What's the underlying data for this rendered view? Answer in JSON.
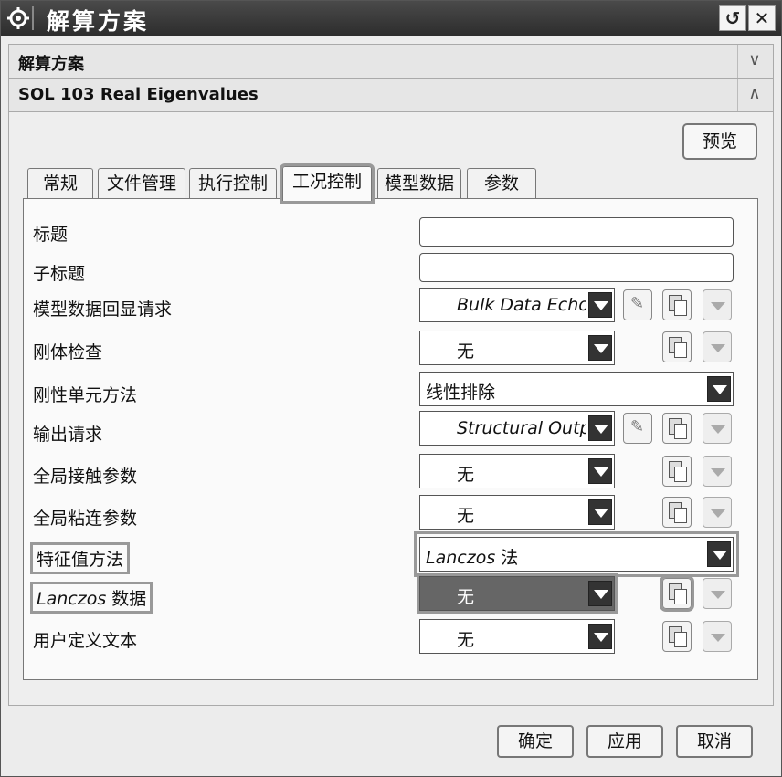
{
  "window": {
    "title": "解算方案",
    "icon": "gear-icon",
    "reset_icon": "↺",
    "close_icon": "✕"
  },
  "groups": {
    "solution": {
      "label": "解算方案",
      "chevron": "∨"
    },
    "sol103": {
      "label": "SOL 103 Real Eigenvalues",
      "chevron": "∧"
    }
  },
  "preview_button": "预览",
  "tabs": [
    {
      "label": "常规"
    },
    {
      "label": "文件管理"
    },
    {
      "label": "执行控制"
    },
    {
      "label": "工况控制"
    },
    {
      "label": "模型数据"
    },
    {
      "label": "参数"
    }
  ],
  "active_tab": "工况控制",
  "rows": {
    "title": {
      "label": "标题",
      "value": ""
    },
    "subtitle": {
      "label": "子标题",
      "value": ""
    },
    "model_echo": {
      "label": "模型数据回显请求",
      "value": "Bulk Data Echo"
    },
    "rigid_check": {
      "label": "刚体检查",
      "value": "无"
    },
    "rigid_method": {
      "label": "刚性单元方法",
      "value": "线性排除"
    },
    "output": {
      "label": "输出请求",
      "value": "Structural Outp"
    },
    "contact": {
      "label": "全局接触参数",
      "value": "无"
    },
    "glue": {
      "label": "全局粘连参数",
      "value": "无"
    },
    "eigen_method": {
      "label": "特征值方法",
      "value_italic": "Lanczos",
      "value_suffix": " 法"
    },
    "lanczos_data": {
      "label_italic": "Lanczos",
      "label_suffix": " 数据",
      "value": "无"
    },
    "user_text": {
      "label": "用户定义文本",
      "value": "无"
    }
  },
  "buttons": {
    "ok": "确定",
    "apply": "应用",
    "cancel": "取消"
  }
}
